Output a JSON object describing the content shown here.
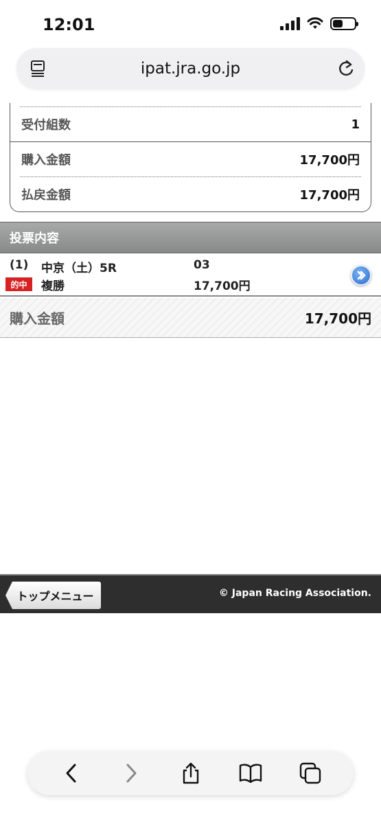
{
  "status_bar": {
    "time": "12:01"
  },
  "browser": {
    "url": "ipat.jra.go.jp"
  },
  "summary": {
    "rows": [
      {
        "label": "受付組数",
        "value": "1"
      },
      {
        "label": "購入金額",
        "value": "17,700円"
      },
      {
        "label": "払戻金額",
        "value": "17,700円"
      }
    ]
  },
  "bets": {
    "header": "投票内容",
    "items": [
      {
        "index": "(1)",
        "race": "中京（土）5R",
        "horse": "03",
        "badge": "的中",
        "type": "複勝",
        "amount": "17,700円"
      }
    ],
    "total_label": "購入金額",
    "total_value": "17,700円"
  },
  "footer": {
    "top_menu_label": "トップメニュー",
    "copyright": "© Japan Racing Association."
  },
  "colors": {
    "hit_badge": "#d62222",
    "section_header": "#979a98",
    "footer": "#2e2e2e",
    "detail_button": "#2a6fd0"
  }
}
